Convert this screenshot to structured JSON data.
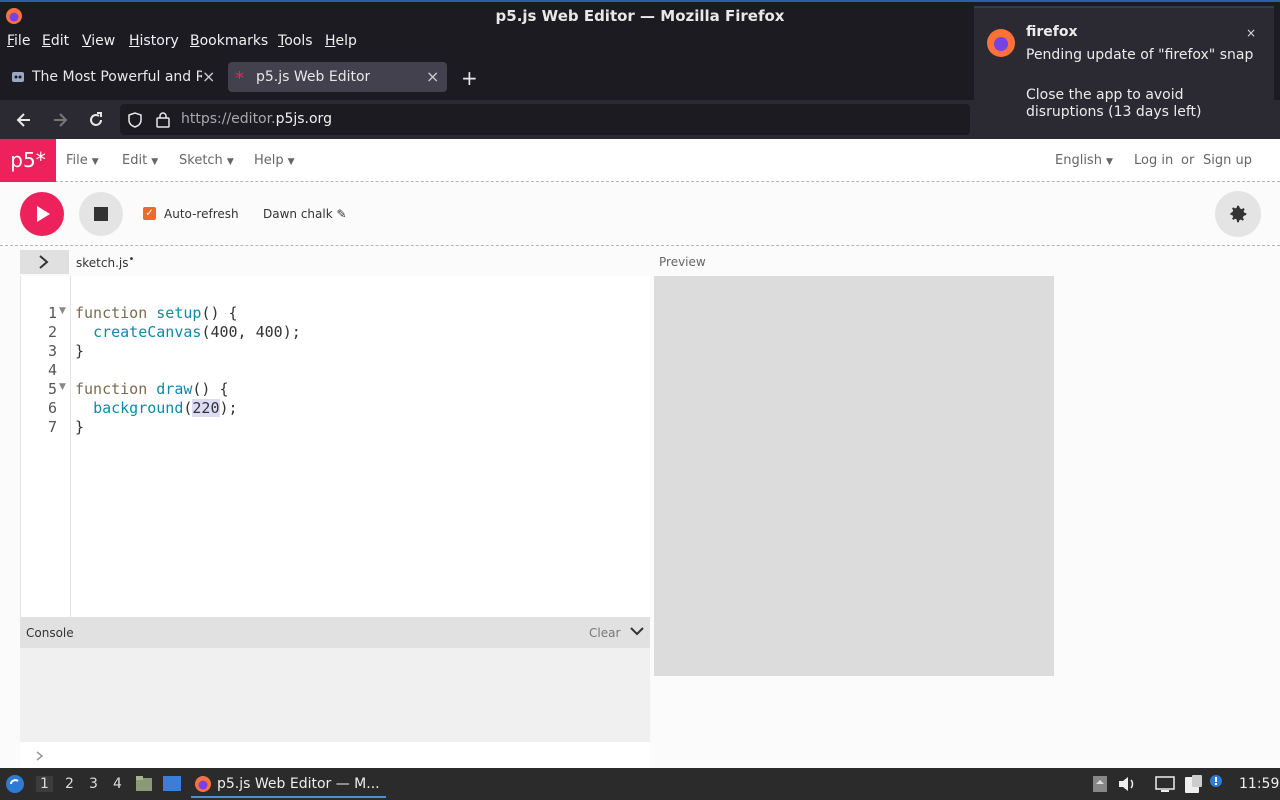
{
  "window": {
    "title": "p5.js Web Editor — Mozilla Firefox"
  },
  "menubar": {
    "items": [
      "File",
      "Edit",
      "View",
      "History",
      "Bookmarks",
      "Tools",
      "Help"
    ]
  },
  "tabs": [
    {
      "label": "The Most Powerful and Re",
      "active": false
    },
    {
      "label": "p5.js Web Editor",
      "active": true
    }
  ],
  "urlbar": {
    "prefix": "https://editor.",
    "domain": "p5js.org"
  },
  "notification": {
    "app": "firefox",
    "line1": "Pending update of \"firefox\" snap",
    "line2": "Close the app to avoid disruptions (13 days left)"
  },
  "editor": {
    "logo": "p5*",
    "nav": [
      "File",
      "Edit",
      "Sketch",
      "Help"
    ],
    "language": "English",
    "login": "Log in",
    "or": "or",
    "signup": "Sign up",
    "autorefresh_label": "Auto-refresh",
    "autorefresh_checked": true,
    "sketch_name": "Dawn chalk",
    "file_tab": "sketch.js",
    "preview_label": "Preview",
    "console_label": "Console",
    "clear_label": "Clear",
    "code": {
      "line_numbers": [
        "1",
        "2",
        "3",
        "4",
        "5",
        "6",
        "7"
      ],
      "l1_kw": "function",
      "l1_fn": "setup",
      "l1_rest": "() {",
      "l2_fn": "createCanvas",
      "l2_rest": "(400, 400);",
      "l3": "}",
      "l5_kw": "function",
      "l5_fn": "draw",
      "l5_rest": "() {",
      "l6_fn": "background",
      "l6_open": "(",
      "l6_num": "220",
      "l6_close": ");",
      "l7": "}"
    },
    "colors": {
      "accent": "#ed225d",
      "preview_bg": "#dcdcdc"
    }
  },
  "taskbar": {
    "workspaces": [
      "1",
      "2",
      "3",
      "4"
    ],
    "window_label": "p5.js Web Editor — M...",
    "clock": "11:59"
  }
}
